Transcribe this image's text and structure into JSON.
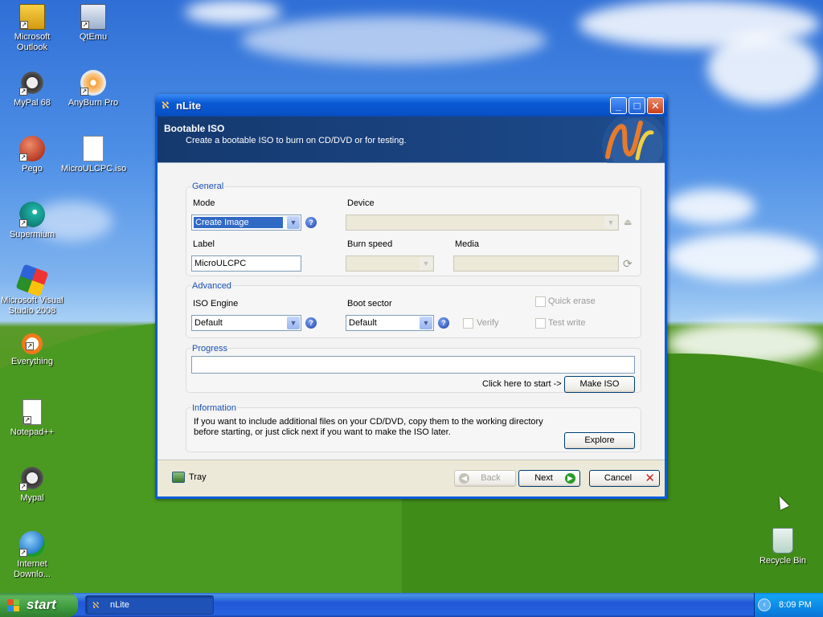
{
  "desktop": {
    "icons": [
      {
        "label": "Microsoft Outlook"
      },
      {
        "label": "QtEmu"
      },
      {
        "label": "MyPal 68"
      },
      {
        "label": "AnyBurn Pro"
      },
      {
        "label": "Pego"
      },
      {
        "label": "MicroULCPC.iso"
      },
      {
        "label": "Supermium"
      },
      {
        "label": "Microsoft Visual Studio 2008"
      },
      {
        "label": "Everything"
      },
      {
        "label": "Notepad++"
      },
      {
        "label": "Mypal"
      },
      {
        "label": "Internet Downlo..."
      },
      {
        "label": "Recycle Bin"
      }
    ]
  },
  "window": {
    "title": "nLite",
    "header": {
      "title": "Bootable ISO",
      "subtitle": "Create a bootable ISO to burn on CD/DVD or for testing."
    },
    "general": {
      "legend": "General",
      "mode_label": "Mode",
      "mode_value": "Create Image",
      "device_label": "Device",
      "device_value": "",
      "label_label": "Label",
      "label_value": "MicroULCPC",
      "burn_speed_label": "Burn speed",
      "burn_speed_value": "",
      "media_label": "Media",
      "media_value": ""
    },
    "advanced": {
      "legend": "Advanced",
      "iso_engine_label": "ISO Engine",
      "iso_engine_value": "Default",
      "boot_sector_label": "Boot sector",
      "boot_sector_value": "Default",
      "verify_label": "Verify",
      "quick_erase_label": "Quick erase",
      "test_write_label": "Test write"
    },
    "progress": {
      "legend": "Progress",
      "hint": "Click here to start ->",
      "make_iso_label": "Make ISO",
      "value": 0
    },
    "information": {
      "legend": "Information",
      "line1": "If you want to include additional files on your CD/DVD, copy them to the working directory",
      "line2": "before starting, or just click next if you want to make the ISO later.",
      "explore_label": "Explore"
    },
    "footer": {
      "tray_label": "Tray",
      "back_label": "Back",
      "next_label": "Next",
      "cancel_label": "Cancel"
    }
  },
  "taskbar": {
    "start_label": "start",
    "task_label": "nLite",
    "clock": "8:09 PM"
  },
  "colors": {
    "xp_blue": "#0b5bd9",
    "group_label": "#1a4fb0",
    "header_bg": "#183f7a",
    "start_green": "#3e9c3e"
  }
}
